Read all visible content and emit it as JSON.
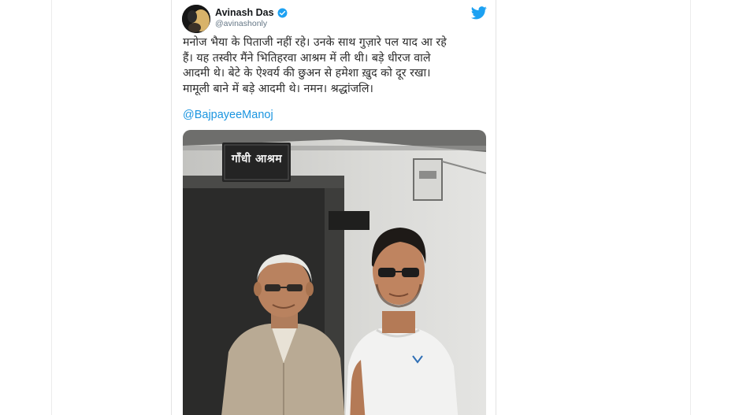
{
  "tweet": {
    "author": {
      "display_name": "Avinash Das",
      "handle": "@avinashonly",
      "verified": true
    },
    "text": "मनोज भैया के पिताजी नहीं रहे। उनके साथ गुज़ारे पल याद आ रहे\nहैं। यह तस्वीर मैंने भितिहरवा आश्रम में ली थी। बड़े धीरज वाले\nआदमी थे। बेटे के ऐश्वर्य की छुअन से हमेशा ख़ुद को दूर रखा।\nमामूली बाने में बड़े आदमी थे। नमन। श्रद्धांजलि।",
    "mention": "@BajpayeeManoj",
    "photo": {
      "sign_text": "गाँधी आश्रम"
    }
  },
  "icons": {
    "verified": "verified-badge-icon",
    "brand": "twitter-bird-icon"
  },
  "colors": {
    "link": "#1b95e0",
    "verified": "#1da1f2",
    "twitter_brand": "#1da1f2",
    "text": "#14171a",
    "secondary_text": "#657786"
  }
}
